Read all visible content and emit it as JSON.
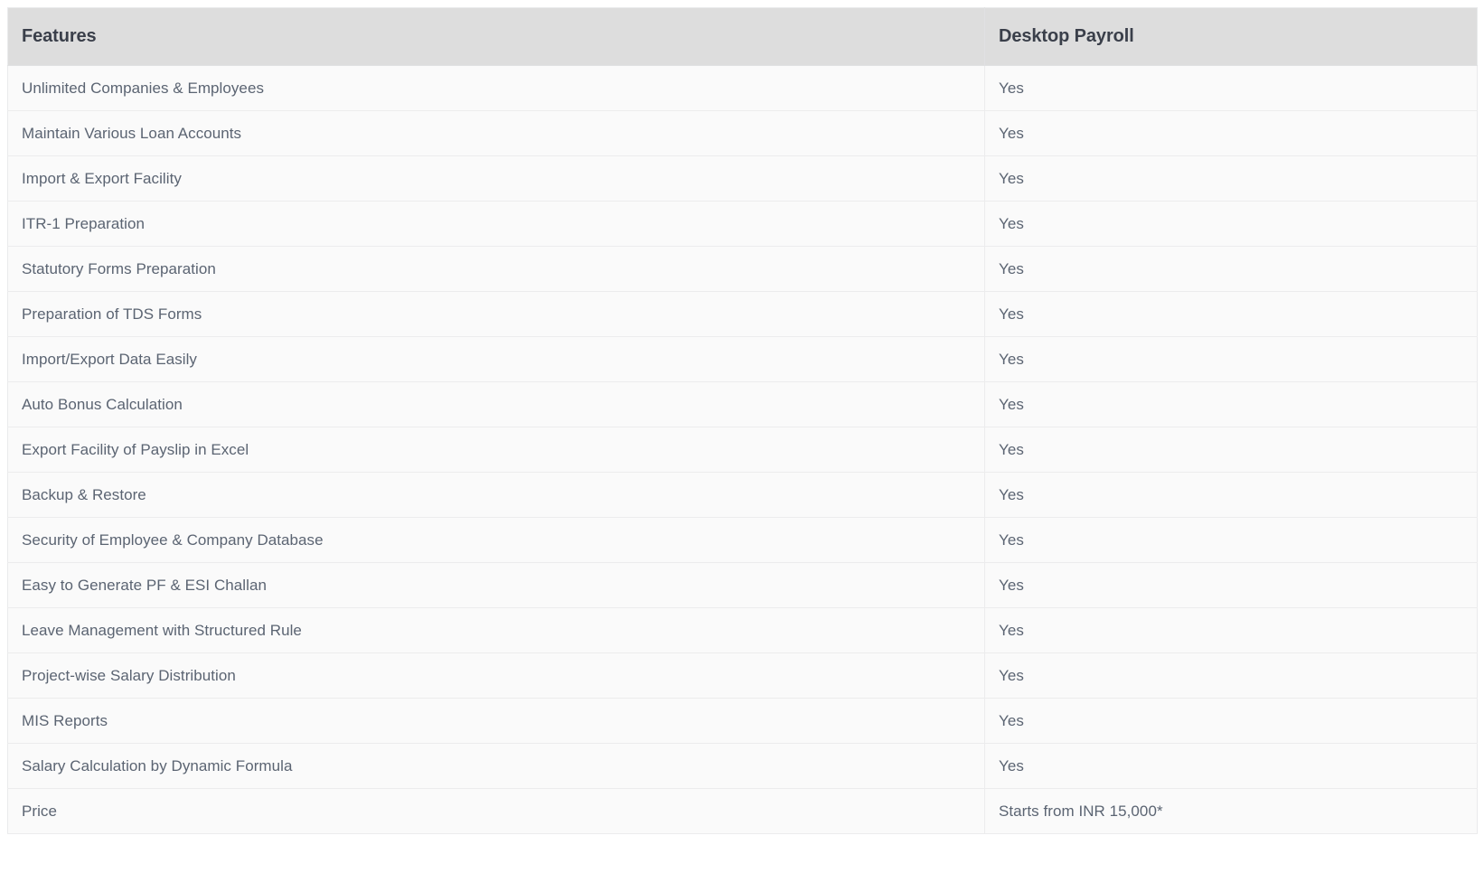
{
  "table": {
    "columns": [
      {
        "key": "feature",
        "label": "Features"
      },
      {
        "key": "desktop_payroll",
        "label": "Desktop Payroll"
      }
    ],
    "rows": [
      {
        "feature": "Unlimited Companies & Employees",
        "desktop_payroll": "Yes"
      },
      {
        "feature": "Maintain Various Loan Accounts",
        "desktop_payroll": "Yes"
      },
      {
        "feature": "Import & Export Facility",
        "desktop_payroll": "Yes"
      },
      {
        "feature": "ITR-1 Preparation",
        "desktop_payroll": "Yes"
      },
      {
        "feature": "Statutory Forms Preparation",
        "desktop_payroll": "Yes"
      },
      {
        "feature": "Preparation of TDS Forms",
        "desktop_payroll": "Yes"
      },
      {
        "feature": "Import/Export Data Easily",
        "desktop_payroll": "Yes"
      },
      {
        "feature": "Auto Bonus Calculation",
        "desktop_payroll": "Yes"
      },
      {
        "feature": "Export Facility of Payslip in Excel",
        "desktop_payroll": "Yes"
      },
      {
        "feature": "Backup & Restore",
        "desktop_payroll": "Yes"
      },
      {
        "feature": "Security of Employee & Company Database",
        "desktop_payroll": "Yes"
      },
      {
        "feature": "Easy to Generate PF & ESI Challan",
        "desktop_payroll": "Yes"
      },
      {
        "feature": "Leave Management with Structured Rule",
        "desktop_payroll": "Yes"
      },
      {
        "feature": "Project-wise Salary Distribution",
        "desktop_payroll": "Yes"
      },
      {
        "feature": "MIS Reports",
        "desktop_payroll": "Yes"
      },
      {
        "feature": "Salary Calculation by Dynamic Formula",
        "desktop_payroll": "Yes"
      },
      {
        "feature": "Price",
        "desktop_payroll": "Starts from INR 15,000*"
      }
    ]
  },
  "colors": {
    "header_bg": "#dddddd",
    "header_text": "#3a3f4a",
    "row_bg": "#fafafa",
    "row_text": "#5b6472",
    "border": "#ececed",
    "page_bg": "#ffffff"
  }
}
